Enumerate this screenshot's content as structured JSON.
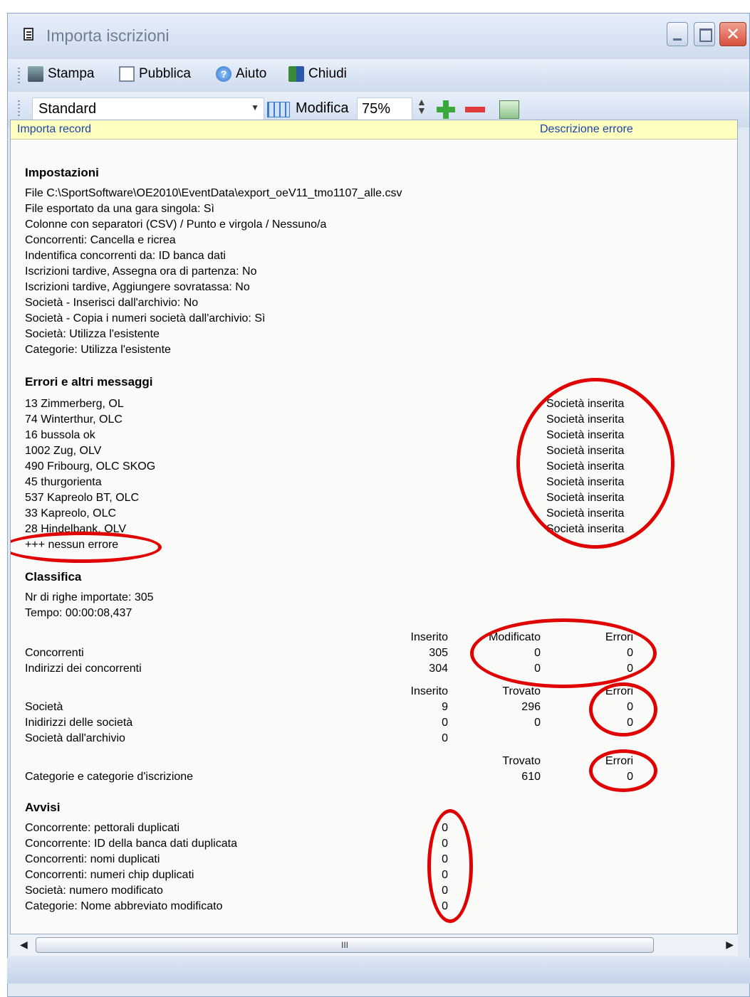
{
  "window": {
    "title": "Importa iscrizioni"
  },
  "toolbar": {
    "print_label": "Stampa",
    "publish_label": "Pubblica",
    "help_label": "Aiuto",
    "close_label": "Chiudi",
    "layout_value": "Standard",
    "modify_label": "Modifica",
    "zoom_value": "75%"
  },
  "report": {
    "header_left": "Importa record",
    "header_right": "Descrizione errore",
    "settings_title": "Impostazioni",
    "settings": [
      "File C:\\SportSoftware\\OE2010\\EventData\\export_oeV11_tmo1107_alle.csv",
      "File esportato da una gara singola: Sì",
      "Colonne con separatori (CSV) / Punto e virgola / Nessuno/a",
      "Concorrenti: Cancella e ricrea",
      "Indentifica concorrenti da: ID banca dati",
      "Iscrizioni tardive, Assegna ora di partenza: No",
      "Iscrizioni tardive, Aggiungere sovratassa: No",
      "Società - Inserisci dall'archivio: No",
      "Società - Copia i numeri società dall'archivio: Sì",
      "Società: Utilizza l'esistente",
      "Categorie: Utilizza l'esistente"
    ],
    "errors_title": "Errori e altri messaggi",
    "errors": [
      {
        "item": "13 Zimmerberg, OL",
        "desc": "Società inserita"
      },
      {
        "item": "74 Winterthur, OLC",
        "desc": "Società inserita"
      },
      {
        "item": "16 bussola ok",
        "desc": "Società inserita"
      },
      {
        "item": "1002 Zug, OLV",
        "desc": "Società inserita"
      },
      {
        "item": "490 Fribourg, OLC SKOG",
        "desc": "Società inserita"
      },
      {
        "item": "45 thurgorienta",
        "desc": "Società inserita"
      },
      {
        "item": "537 Kapreolo BT, OLC",
        "desc": "Società inserita"
      },
      {
        "item": "33 Kapreolo, OLC",
        "desc": "Società inserita"
      },
      {
        "item": "28 Hindelbank, OLV",
        "desc": "Società inserita"
      }
    ],
    "no_errors": "+++ nessun errore",
    "summary_title": "Classifica",
    "rows_imported": "Nr di righe importate: 305",
    "time": "Tempo: 00:00:08,437",
    "competitors": {
      "col1": "Inserito",
      "col2": "Modificato",
      "col3": "Errori",
      "rows": [
        {
          "label": "Concorrenti",
          "v1": "305",
          "v2": "0",
          "v3": "0"
        },
        {
          "label": "Indirizzi dei concorrenti",
          "v1": "304",
          "v2": "0",
          "v3": "0"
        }
      ]
    },
    "clubs": {
      "col1": "Inserito",
      "col2": "Trovato",
      "col3": "Errori",
      "rows": [
        {
          "label": "Società",
          "v1": "9",
          "v2": "296",
          "v3": "0"
        },
        {
          "label": "Inidirizzi delle società",
          "v1": "0",
          "v2": "0",
          "v3": "0"
        },
        {
          "label": "Società dall'archivio",
          "v1": "0"
        }
      ]
    },
    "classes": {
      "col2": "Trovato",
      "col3": "Errori",
      "rows": [
        {
          "label": "Categorie e categorie d'iscrizione",
          "v2": "610",
          "v3": "0"
        }
      ]
    },
    "warnings_title": "Avvisi",
    "warnings": [
      {
        "label": "Concorrente: pettorali duplicati",
        "value": "0"
      },
      {
        "label": "Concorrente: ID della banca dati duplicata",
        "value": "0"
      },
      {
        "label": "Concorrenti: nomi duplicati",
        "value": "0"
      },
      {
        "label": "Concorrenti: numeri chip duplicati",
        "value": "0"
      },
      {
        "label": "Società: numero modificato",
        "value": "0"
      },
      {
        "label": "Categorie: Nome abbreviato modificato",
        "value": "0"
      }
    ]
  },
  "scrollbar": {
    "thumb_grip": "III"
  },
  "colors": {
    "annotation": "#e00000",
    "header_bg": "#ffffc0",
    "header_text": "#1a45a8"
  }
}
